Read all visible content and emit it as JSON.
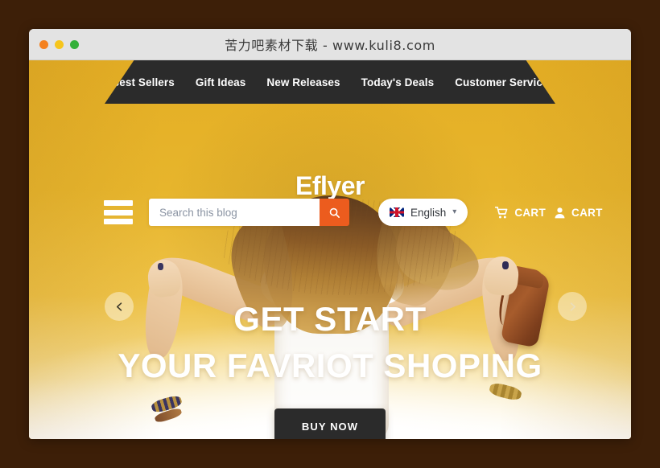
{
  "window": {
    "title": "苦力吧素材下载 - www.kuli8.com",
    "traffic_lights": [
      {
        "name": "close",
        "color": "#f4811f"
      },
      {
        "name": "minimize",
        "color": "#f6c51c"
      },
      {
        "name": "zoom",
        "color": "#33b03a"
      }
    ]
  },
  "nav": {
    "items": [
      {
        "label": "Best Sellers"
      },
      {
        "label": "Gift Ideas"
      },
      {
        "label": "New Releases"
      },
      {
        "label": "Today's Deals"
      },
      {
        "label": "Customer Service"
      }
    ]
  },
  "brand": {
    "logo_text": "Eflyer"
  },
  "utility": {
    "menu_icon": "hamburger-icon",
    "search": {
      "placeholder": "Search this blog",
      "value": "",
      "button_icon": "search-icon",
      "button_color": "#ec5c1e"
    },
    "language": {
      "flag_icon": "uk-flag-icon",
      "label": "English",
      "chevron": "▾"
    },
    "account": [
      {
        "icon": "shopping-cart-icon",
        "label": "CART"
      },
      {
        "icon": "user-icon",
        "label": "CART"
      }
    ]
  },
  "hero": {
    "headline_line1": "GET START",
    "headline_line2": "YOUR FAVRIOT SHOPING",
    "cta_label": "BUY NOW",
    "prev_icon": "chevron-left-icon",
    "next_icon": "chevron-right-icon"
  },
  "colors": {
    "page_background": "#3d1f08",
    "titlebar": "#e3e3e3",
    "nav_background": "#2b2b2b",
    "hero_gold": "#e4ae24",
    "accent_orange": "#ec5c1e",
    "dark": "#2b2b2b"
  }
}
